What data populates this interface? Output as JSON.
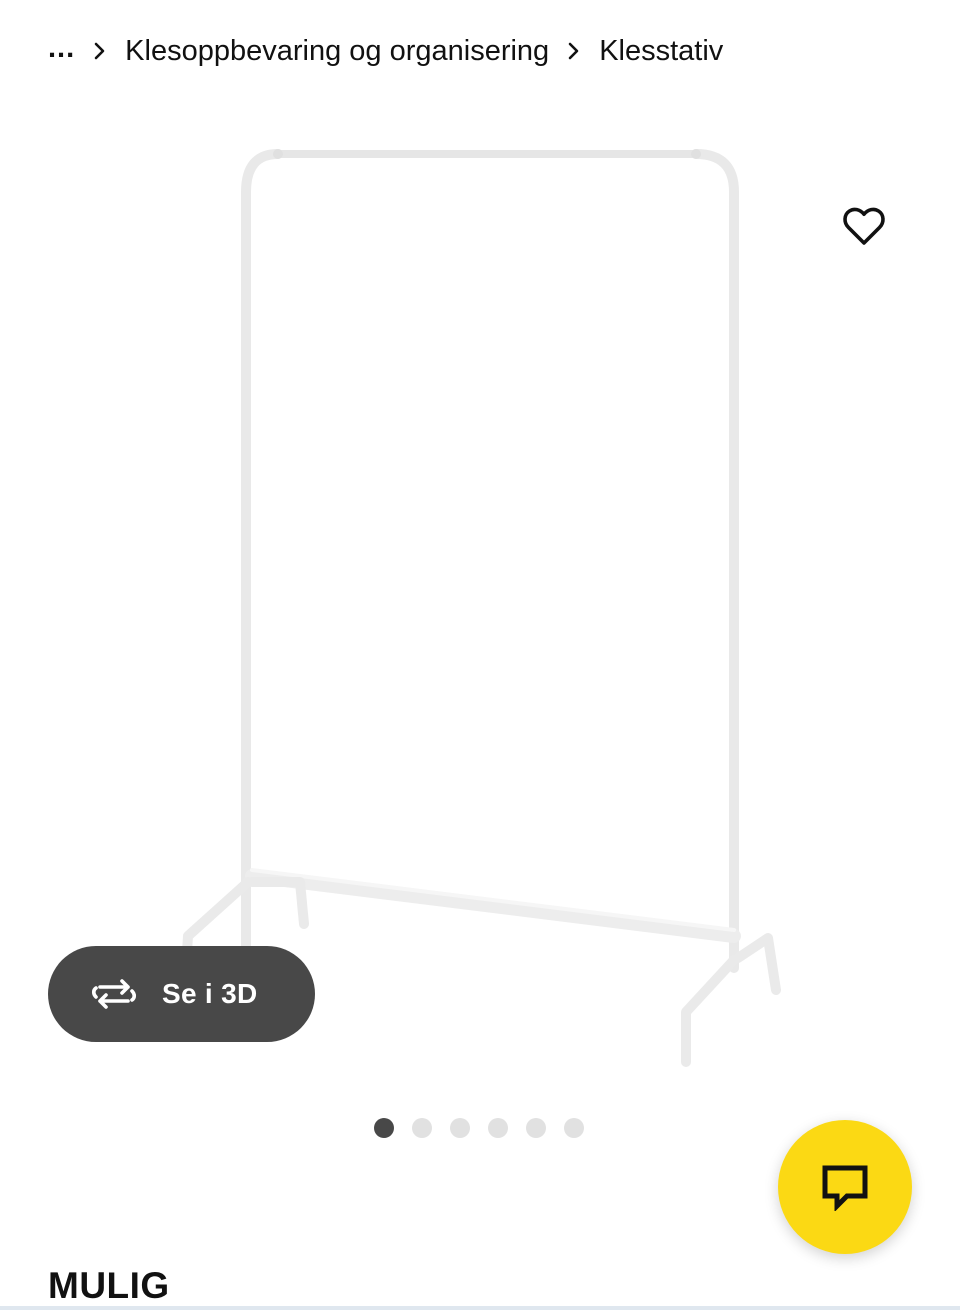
{
  "breadcrumb": {
    "ellipsis": "...",
    "items": [
      {
        "label": "Klesoppbevaring og organisering"
      },
      {
        "label": "Klesstativ"
      }
    ],
    "separator_icon": "chevron-right-icon"
  },
  "product": {
    "image_alt_icon": "clothes-rack-image",
    "favourite_icon": "heart-outline-icon",
    "view_3d": {
      "label": "Se i 3D",
      "icon": "rotate-3d-icon"
    },
    "gallery": {
      "total_images": 6,
      "active_index": 0
    },
    "name": "MULIG"
  },
  "chat": {
    "icon": "chat-bubble-icon"
  },
  "colors": {
    "accent_yellow": "#fbd914",
    "button_dark": "#484848",
    "dot_inactive": "#e1e1e1",
    "text": "#111111"
  }
}
